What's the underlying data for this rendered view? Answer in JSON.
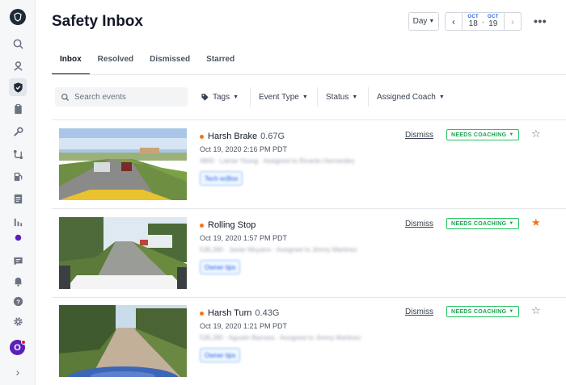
{
  "app": {
    "avatar_initial": "O"
  },
  "header": {
    "title": "Safety Inbox",
    "range_select": "Day",
    "date_from": {
      "month": "OCT",
      "day": "18"
    },
    "date_to": {
      "month": "OCT",
      "day": "19"
    },
    "date_separator": "-",
    "more": "•••"
  },
  "tabs": [
    {
      "label": "Inbox",
      "active": true
    },
    {
      "label": "Resolved",
      "active": false
    },
    {
      "label": "Dismissed",
      "active": false
    },
    {
      "label": "Starred",
      "active": false
    }
  ],
  "filters": {
    "search_placeholder": "Search events",
    "tags_label": "Tags",
    "event_type_label": "Event Type",
    "status_label": "Status",
    "assigned_coach_label": "Assigned Coach"
  },
  "events": [
    {
      "type": "Harsh Brake",
      "gforce": "0.67G",
      "time": "Oct 19, 2020 2:16 PM PDT",
      "meta": "4800 · Lamar Young · Assigned to Ricardo Hernandez",
      "tag": "Tech ecBox",
      "action": "Dismiss",
      "status": "NEEDS COACHING",
      "starred": false
    },
    {
      "type": "Rolling Stop",
      "gforce": "",
      "time": "Oct 19, 2020 1:57 PM PDT",
      "meta": "536,260 · Javier Moyano · Assigned to Jimmy Martinez",
      "tag": "Owner tips",
      "action": "Dismiss",
      "status": "NEEDS COACHING",
      "starred": true
    },
    {
      "type": "Harsh Turn",
      "gforce": "0.43G",
      "time": "Oct 19, 2020 1:21 PM PDT",
      "meta": "536,280 · Agustin Barraza · Assigned to Jimmy Martinez",
      "tag": "Owner tips",
      "action": "Dismiss",
      "status": "NEEDS COACHING",
      "starred": false
    }
  ],
  "colors": {
    "accent_orange": "#f97316",
    "coaching_green": "#16a34a",
    "link_blue": "#2563eb"
  },
  "icons": {
    "star_outline": "☆",
    "star_filled": "★",
    "caret": "▼",
    "chev_left": "‹",
    "chev_right": "›",
    "sidebar_expand": "›"
  }
}
